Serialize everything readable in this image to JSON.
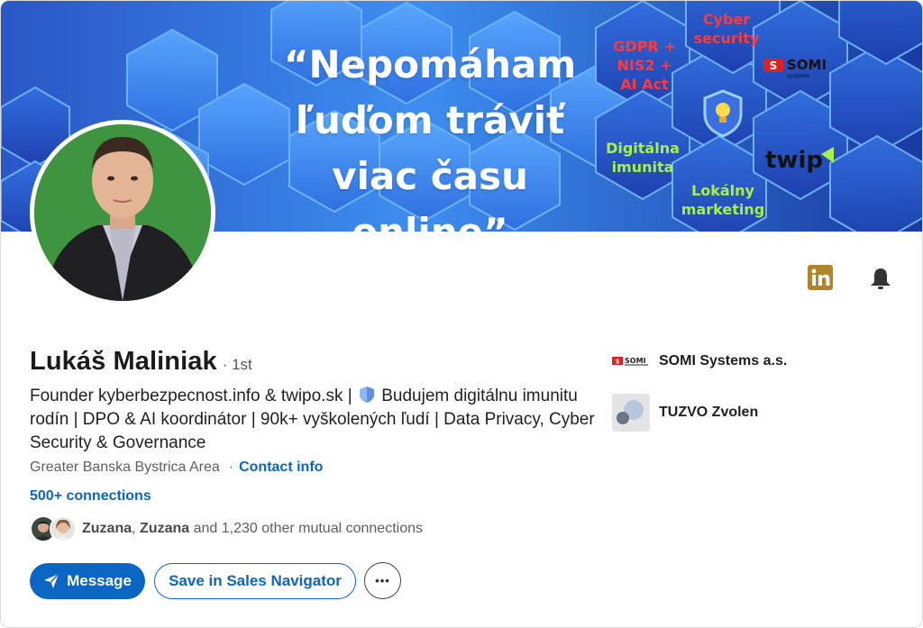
{
  "banner": {
    "quote_line1": "“Nepomáham",
    "quote_line2": "ľuďom tráviť",
    "quote_line3": "viac času online”",
    "tag_gdpr": "GDPR +\nNIS2 +\nAI Act",
    "tag_cyber": "Cyber\nsecurity",
    "tag_digital": "Digitálna\nimunita",
    "tag_local": "Lokálny\nmarketing",
    "logo_somi": "SOMI",
    "logo_somi_sub": "systems",
    "logo_twip": "twip",
    "colors": {
      "sky": "#3d8ef0",
      "deep": "#1f3fa8",
      "red_text": "#ff3a3a",
      "green_text": "#a6f04a"
    }
  },
  "profile": {
    "name": "Lukáš Maliniak",
    "degree": "· 1st",
    "headline_part1": "Founder kyberbezpecnost.info & twipo.sk |",
    "headline_part2": "Budujem digitálnu imunitu rodín | DPO & AI koordinátor | 90k+ vyškolených ľudí | Data Privacy, Cyber Security & Governance",
    "location": "Greater Banska Bystrica Area",
    "contact_info": "Contact info",
    "connections": "500+ connections",
    "mutual_name1": "Zuzana",
    "mutual_name2": "Zuzana",
    "mutual_rest": "and 1,230 other mutual connections"
  },
  "actions": {
    "message": "Message",
    "save_sales_nav": "Save in Sales Navigator",
    "more": "•••"
  },
  "companies": [
    {
      "name": "SOMI Systems a.s.",
      "icon": "somi-logo"
    },
    {
      "name": "TUZVO Zvolen",
      "icon": "tuzvo-logo"
    }
  ],
  "icons": {
    "linkedin": "linkedin-icon",
    "bell": "bell-icon",
    "send": "send-icon",
    "shield": "shield-icon"
  },
  "colors": {
    "accent": "#0a66c2",
    "linkedin_gold": "#b0842a"
  }
}
